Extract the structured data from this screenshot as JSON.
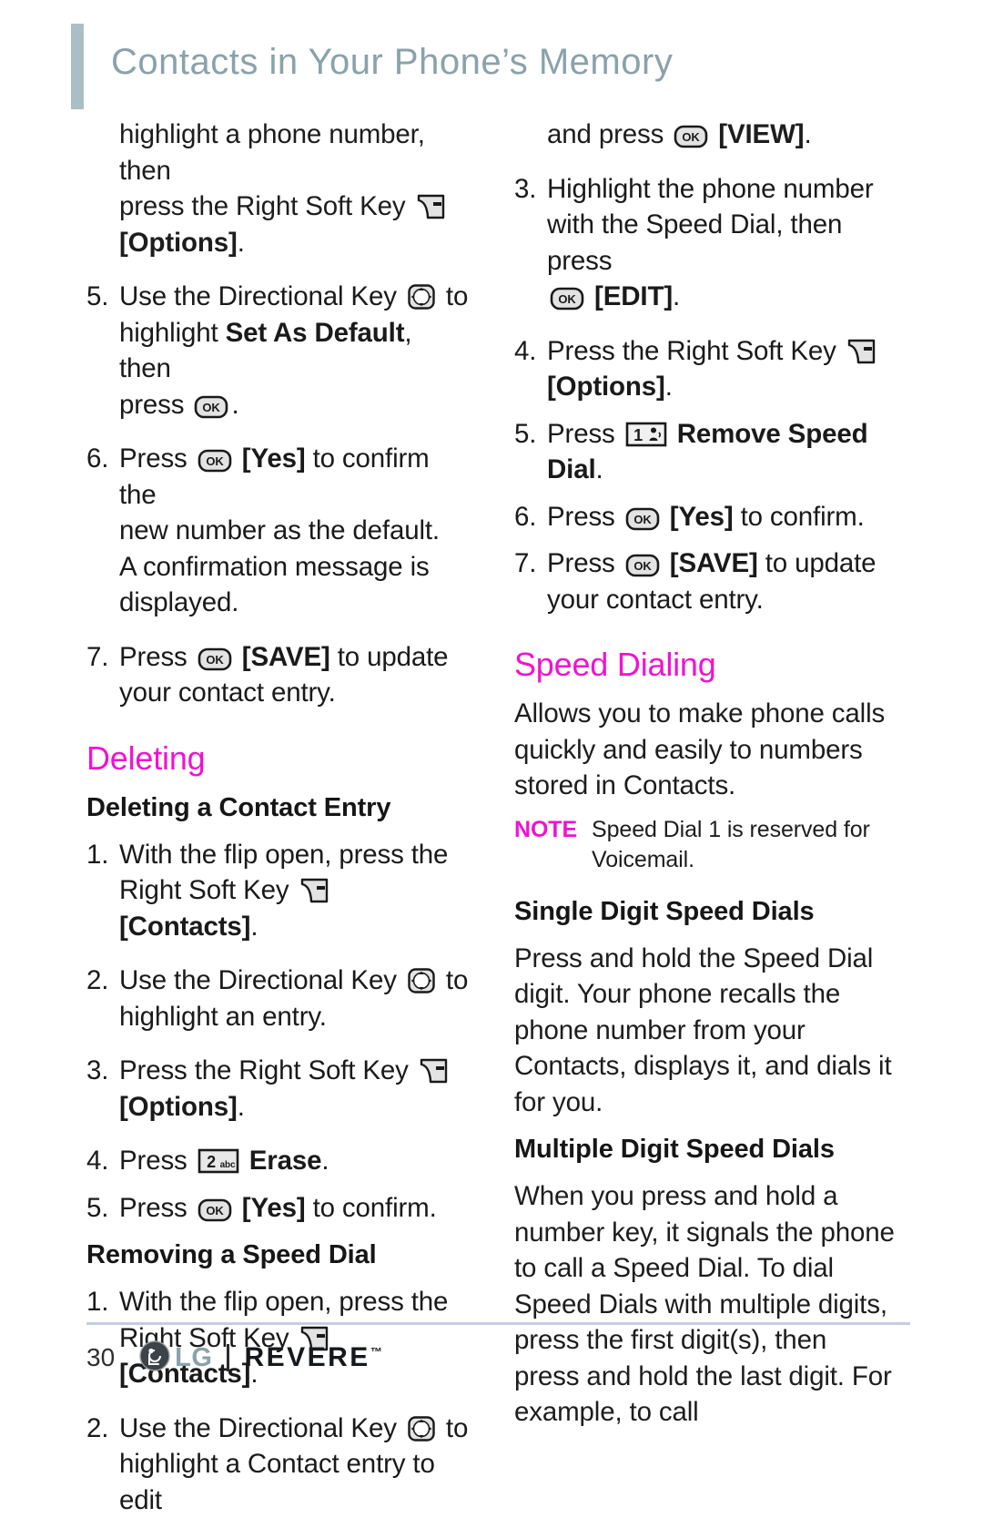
{
  "header": {
    "title": "Contacts in Your Phone’s Memory",
    "accent_bar_color": "#a9bfc5",
    "title_color": "#8aa2aa"
  },
  "colors": {
    "pink": "#f012d2",
    "body": "#1d1d1d",
    "rule": "#c6cddd"
  },
  "icons": {
    "right_soft_key": "right-soft-key-icon",
    "directional_key": "directional-key-icon",
    "ok_key": "ok-key-icon",
    "key_2_abc": "key-2-abc-icon",
    "key_1_voicemail": "key-1-voicemail-icon"
  },
  "left_column": {
    "carryover_step": {
      "line1": "highlight a phone number, then",
      "line2_a": "press the Right Soft Key",
      "line3_bold": "[Options]",
      "line3_tail": "."
    },
    "step5": {
      "num": "5.",
      "a": "Use the Directional Key",
      "b": "to",
      "c": "highlight",
      "c_bold": "Set As Default",
      "d": ", then",
      "e": "press",
      "f": "."
    },
    "step6": {
      "num": "6.",
      "a": "Press",
      "b_bold": "[Yes]",
      "c": "to confirm the",
      "d": "new number as the default.",
      "e": "A confirmation message is",
      "f": "displayed."
    },
    "step7": {
      "num": "7.",
      "a": "Press",
      "b_bold": "[SAVE]",
      "c": "to update",
      "d": "your contact entry."
    },
    "heading_deleting": "Deleting",
    "subheading_deleting_entry": "Deleting a Contact Entry",
    "del_step1": {
      "num": "1.",
      "a": "With the flip open, press the",
      "b": "Right Soft Key",
      "c_bold": "[Contacts]",
      "d": "."
    },
    "del_step2": {
      "num": "2.",
      "a": "Use the Directional Key",
      "b": "to",
      "c": "highlight an entry."
    },
    "del_step3": {
      "num": "3.",
      "a": "Press the Right Soft Key",
      "b_bold": "[Options]",
      "c": "."
    },
    "del_step4": {
      "num": "4.",
      "a": "Press",
      "b_bold": "Erase",
      "c": "."
    },
    "del_step5": {
      "num": "5.",
      "a": "Press",
      "b_bold": "[Yes]",
      "c": "to confirm."
    },
    "subheading_removing_speed_dial": "Removing a Speed Dial",
    "rm_step1": {
      "num": "1.",
      "a": "With the flip open, press the",
      "b": "Right Soft Key",
      "c_bold": "[Contacts]",
      "d": "."
    },
    "rm_step2": {
      "num": "2.",
      "a": "Use the Directional Key",
      "b": "to",
      "c": "highlight a Contact entry to edit"
    }
  },
  "right_column": {
    "carryover": {
      "a": "and press",
      "b_bold": "[VIEW]",
      "c": "."
    },
    "step3": {
      "num": "3.",
      "a": "Highlight the phone number",
      "b": "with the Speed Dial, then press",
      "c_bold": "[EDIT]",
      "d": "."
    },
    "step4": {
      "num": "4.",
      "a": "Press the Right Soft Key",
      "b_bold": "[Options]",
      "c": "."
    },
    "step5": {
      "num": "5.",
      "a": "Press",
      "b_bold": "Remove Speed Dial",
      "c": "."
    },
    "step6": {
      "num": "6.",
      "a": "Press",
      "b_bold": "[Yes]",
      "c": "to confirm."
    },
    "step7": {
      "num": "7.",
      "a": "Press",
      "b_bold": "[SAVE]",
      "c": "to update",
      "d": "your contact entry."
    },
    "heading_speed_dialing": "Speed Dialing",
    "speed_dialing_body": "Allows you to make phone calls quickly and easily to numbers stored in Contacts.",
    "note": {
      "label": "NOTE",
      "body": "Speed Dial 1 is reserved for Voicemail."
    },
    "subheading_single": "Single Digit Speed Dials",
    "single_body": "Press and hold the Speed Dial digit. Your phone recalls the phone number from your Contacts, displays it, and dials it for you.",
    "subheading_multiple": "Multiple Digit Speed Dials",
    "multiple_body": "When you press and hold a number key, it signals the phone to call a Speed Dial. To dial Speed Dials with multiple digits, press the first digit(s), then press and hold the last digit. For example, to call"
  },
  "footer": {
    "page_number": "30",
    "brand": "LG",
    "model": "REVERE",
    "trademark": "™"
  }
}
